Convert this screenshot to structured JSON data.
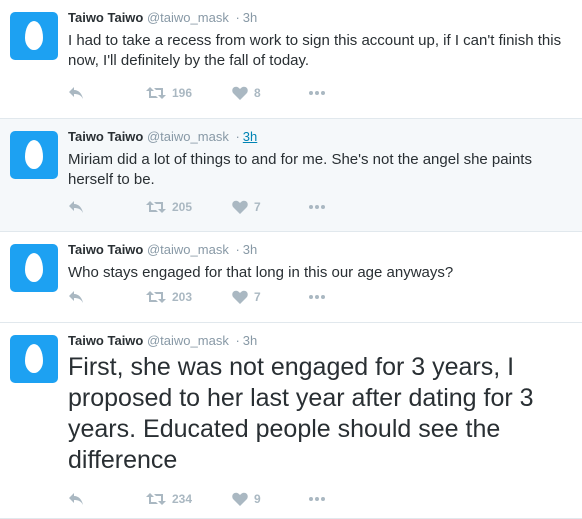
{
  "tweets": [
    {
      "name": "Taiwo Taiwo",
      "handle": "@taiwo_mask",
      "separator": "·",
      "time": "3h",
      "text": "I had to take a recess from work to sign this account up, if I can't finish this now, I'll definitely by the fall of today.",
      "retweets": "196",
      "likes": "8",
      "highlighted": false
    },
    {
      "name": "Taiwo Taiwo",
      "handle": "@taiwo_mask",
      "separator": "·",
      "time": "3h",
      "text": "Miriam did a lot of things to and for me. She's not the angel she paints herself to be.",
      "retweets": "205",
      "likes": "7",
      "highlighted": true
    },
    {
      "name": "Taiwo Taiwo",
      "handle": "@taiwo_mask",
      "separator": "·",
      "time": "3h",
      "text": "Who stays engaged for that long in this our age anyways?",
      "retweets": "203",
      "likes": "7",
      "highlighted": false
    },
    {
      "name": "Taiwo Taiwo",
      "handle": "@taiwo_mask",
      "separator": "·",
      "time": "3h",
      "text": "First, she was not engaged for 3 years, I proposed to her last year after dating for 3 years. Educated people should see the difference",
      "retweets": "234",
      "likes": "9",
      "highlighted": false
    }
  ],
  "icons": {
    "avatar": "default-egg-avatar",
    "reply": "reply-icon",
    "retweet": "retweet-icon",
    "like": "heart-icon",
    "more": "more-icon"
  },
  "colors": {
    "avatar_bg": "#1da1f2",
    "icon_gray": "#aab8c2",
    "highlight_bg": "#f5f8fa",
    "link": "#0084b4"
  }
}
